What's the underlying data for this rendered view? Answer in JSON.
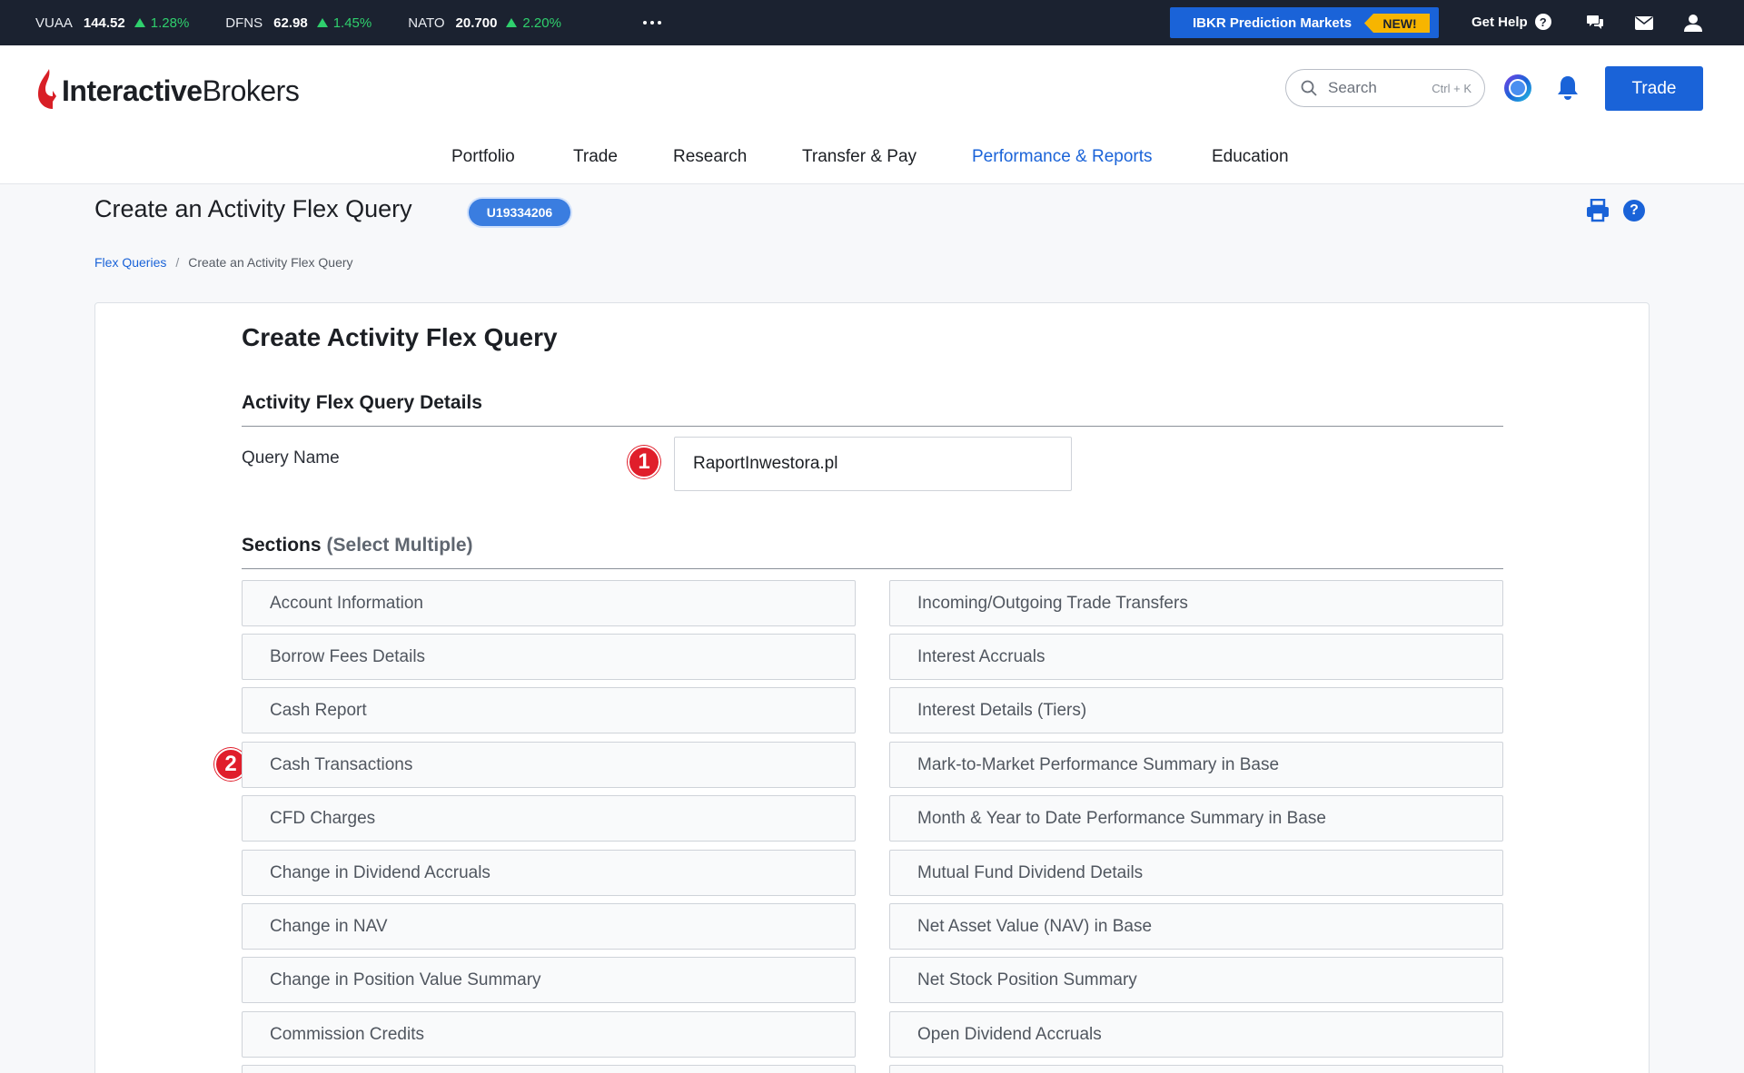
{
  "tickers": [
    {
      "symbol": "VUAA",
      "price": "144.52",
      "change": "1.28%"
    },
    {
      "symbol": "DFNS",
      "price": "62.98",
      "change": "1.45%"
    },
    {
      "symbol": "NATO",
      "price": "20.700",
      "change": "2.20%"
    }
  ],
  "topbar": {
    "promo_label": "IBKR Prediction Markets",
    "promo_badge": "NEW!",
    "get_help": "Get Help"
  },
  "logo": {
    "part1": "Interactive",
    "part2": "Brokers"
  },
  "search": {
    "placeholder": "Search",
    "shortcut": "Ctrl + K"
  },
  "trade_button": "Trade",
  "nav": {
    "items": [
      {
        "label": "Portfolio"
      },
      {
        "label": "Trade"
      },
      {
        "label": "Research"
      },
      {
        "label": "Transfer & Pay"
      },
      {
        "label": "Performance & Reports"
      },
      {
        "label": "Education"
      }
    ],
    "active": "Performance & Reports"
  },
  "page": {
    "title": "Create an Activity Flex Query",
    "account_badge": "U19334206",
    "breadcrumb": {
      "link": "Flex Queries",
      "separator": "/",
      "current": "Create an Activity Flex Query"
    }
  },
  "form": {
    "title": "Create Activity Flex Query",
    "details_heading": "Activity Flex Query Details",
    "query_name_label": "Query Name",
    "query_name_value": "RaportInwestora.pl",
    "sections_heading": "Sections",
    "sections_hint": "(Select Multiple)",
    "markers": [
      "1",
      "2"
    ]
  },
  "sections": {
    "left": [
      "Account Information",
      "Borrow Fees Details",
      "Cash Report",
      "Cash Transactions",
      "CFD Charges",
      "Change in Dividend Accruals",
      "Change in NAV",
      "Change in Position Value Summary",
      "Commission Credits",
      ""
    ],
    "right": [
      "Incoming/Outgoing Trade Transfers",
      "Interest Accruals",
      "Interest Details (Tiers)",
      "Mark-to-Market Performance Summary in Base",
      "Month & Year to Date Performance Summary in Base",
      "Mutual Fund Dividend Details",
      "Net Asset Value (NAV) in Base",
      "Net Stock Position Summary",
      "Open Dividend Accruals",
      ""
    ]
  },
  "colors": {
    "brand_blue": "#1a63d8",
    "topbar_bg": "#1b2230",
    "positive": "#2fd06d",
    "marker_red": "#e01e2b",
    "badge_yellow": "#f7b500"
  }
}
